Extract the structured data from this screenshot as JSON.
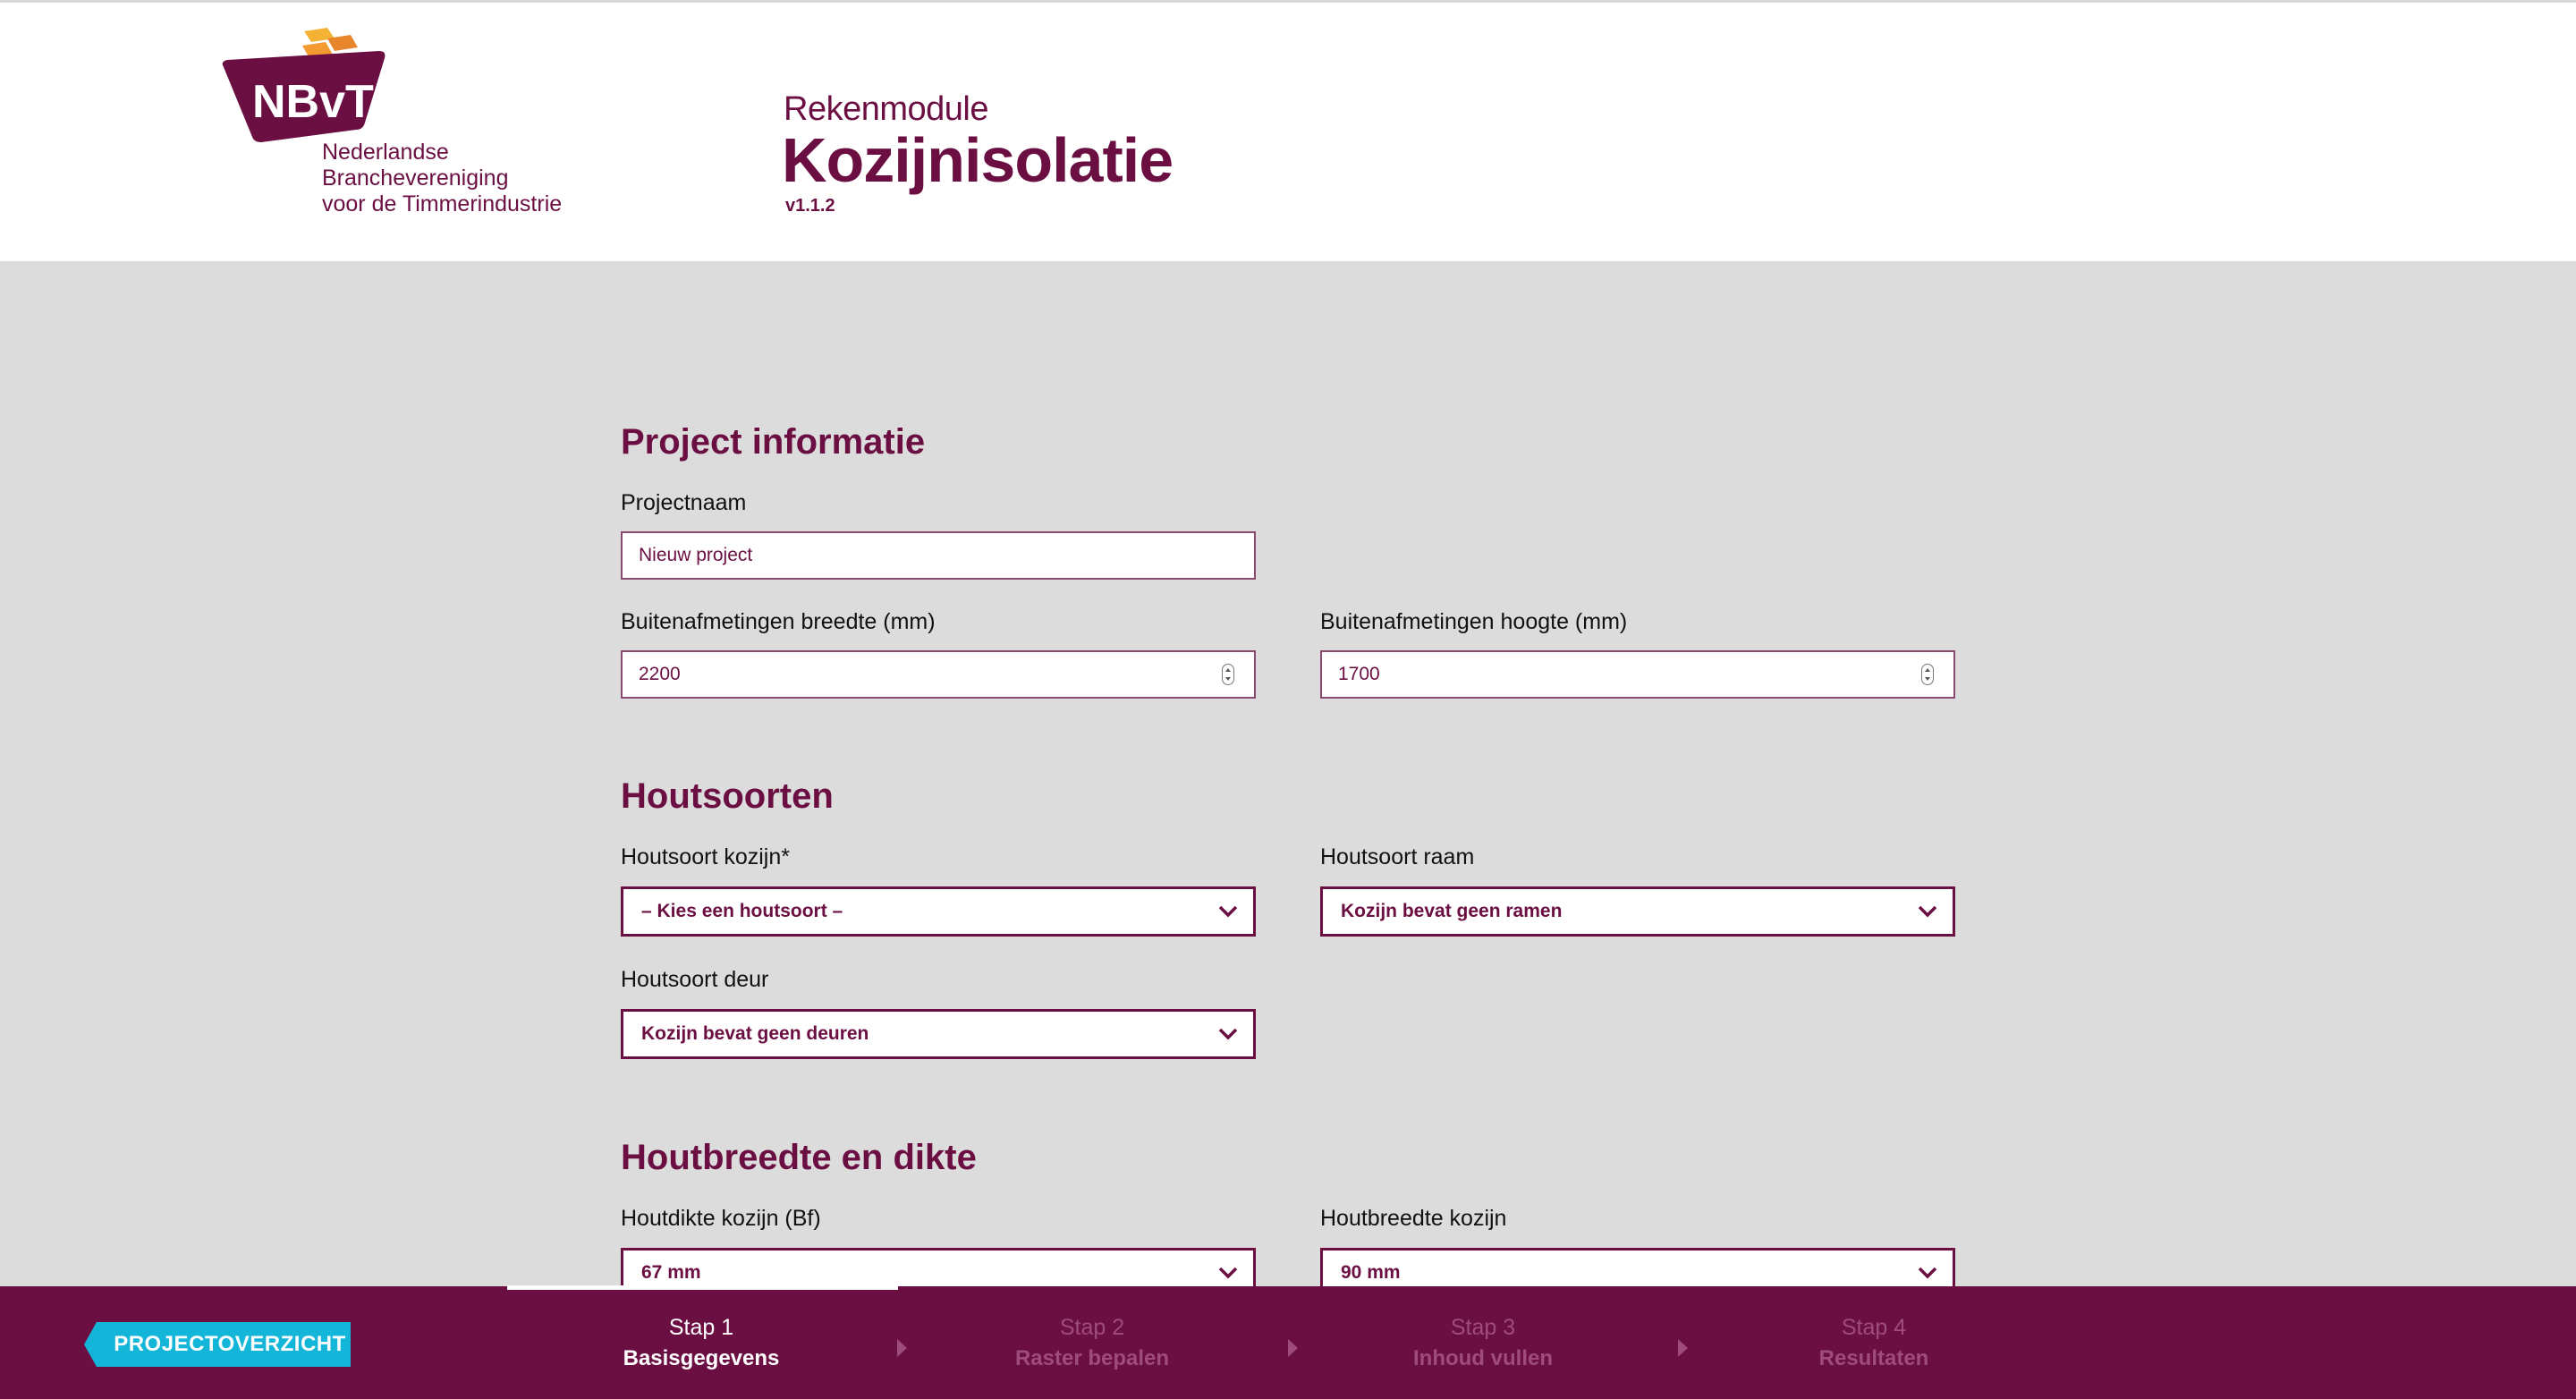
{
  "header": {
    "logo": {
      "mark": "NBvT",
      "lines": [
        "Nederlandse",
        "Branchevereniging",
        "voor de Timmerindustrie"
      ]
    },
    "subtitle": "Rekenmodule",
    "title": "Kozijnisolatie",
    "version": "v1.1.2"
  },
  "sections": {
    "project": {
      "title": "Project informatie",
      "projectnaam_label": "Projectnaam",
      "projectnaam_value": "Nieuw project",
      "breedte_label": "Buitenafmetingen breedte (mm)",
      "breedte_value": "2200",
      "hoogte_label": "Buitenafmetingen hoogte (mm)",
      "hoogte_value": "1700"
    },
    "houtsoorten": {
      "title": "Houtsoorten",
      "kozijn_label": "Houtsoort kozijn*",
      "kozijn_value": "– Kies een houtsoort –",
      "raam_label": "Houtsoort raam",
      "raam_value": "Kozijn bevat geen ramen",
      "deur_label": "Houtsoort deur",
      "deur_value": "Kozijn bevat geen deuren"
    },
    "houtbreedte": {
      "title": "Houtbreedte en dikte",
      "dikte_label": "Houtdikte kozijn (Bf)",
      "dikte_value": "67 mm",
      "breedte_label": "Houtbreedte kozijn",
      "breedte_value": "90 mm"
    }
  },
  "footer": {
    "back_button": "PROJECTOVERZICHT",
    "current_step_progress": 1,
    "steps": [
      {
        "num": "Stap 1",
        "name": "Basisgegevens",
        "active": true
      },
      {
        "num": "Stap 2",
        "name": "Raster bepalen",
        "active": false
      },
      {
        "num": "Stap 3",
        "name": "Inhoud vullen",
        "active": false
      },
      {
        "num": "Stap 4",
        "name": "Resultaten",
        "active": false
      }
    ]
  },
  "colors": {
    "brand": "#6b0f43",
    "accent": "#13b5d8",
    "background": "#dcdcdc",
    "logo_orange": "#e8862b",
    "logo_yellow": "#f5b335"
  },
  "icons": {
    "select_arrow": "chevron-down-icon",
    "number_spinner": "spinner-icon",
    "step_separator": "triangle-right-icon"
  }
}
